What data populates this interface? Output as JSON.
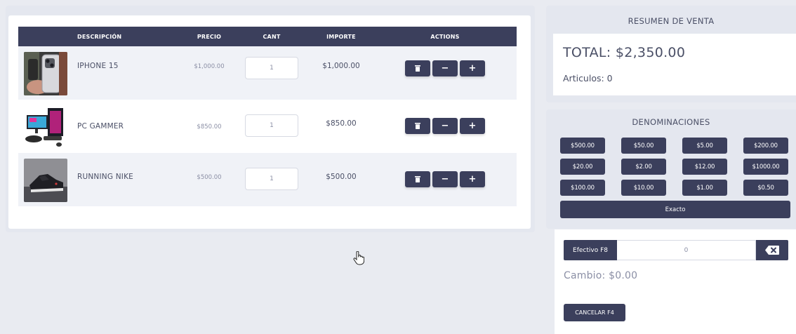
{
  "cart": {
    "headers": {
      "description": "DESCRIPCIÓN",
      "price": "PRECIO",
      "qty": "CANT",
      "amount": "IMPORTE",
      "actions": "ACTIONS"
    },
    "items": [
      {
        "name": "IPHONE 15",
        "price": "$1,000.00",
        "qty": "1",
        "amount": "$1,000.00",
        "image": "iphone-photo"
      },
      {
        "name": "PC GAMMER",
        "price": "$850.00",
        "qty": "1",
        "amount": "$850.00",
        "image": "gaming-pc-photo"
      },
      {
        "name": "RUNNING NIKE",
        "price": "$500.00",
        "qty": "1",
        "amount": "$500.00",
        "image": "sneaker-photo"
      }
    ],
    "action_icons": {
      "delete": "trash-icon",
      "decrease": "minus-icon",
      "increase": "plus-icon"
    },
    "action_glyphs": {
      "decrease": "−",
      "increase": "+"
    }
  },
  "summary": {
    "title": "RESUMEN DE VENTA",
    "total": "TOTAL: $2,350.00",
    "articles": "Articulos: 0"
  },
  "denominations": {
    "title": "DENOMINACIONES",
    "values": [
      "$500.00",
      "$50.00",
      "$5.00",
      "$200.00",
      "$20.00",
      "$2.00",
      "$12.00",
      "$1000.00",
      "$100.00",
      "$10.00",
      "$1.00",
      "$0.50"
    ],
    "exact_label": "Exacto"
  },
  "payment": {
    "label": "Efectivo F8",
    "value": "0",
    "change": "Cambio: $0.00",
    "cancel_label": "CANCELAR F4"
  },
  "colors": {
    "primary": "#3b3f5c",
    "background": "#e9ebf1",
    "row_alt": "#f0f2f7",
    "text": "#4a4f66",
    "muted": "#8b8fa5"
  }
}
